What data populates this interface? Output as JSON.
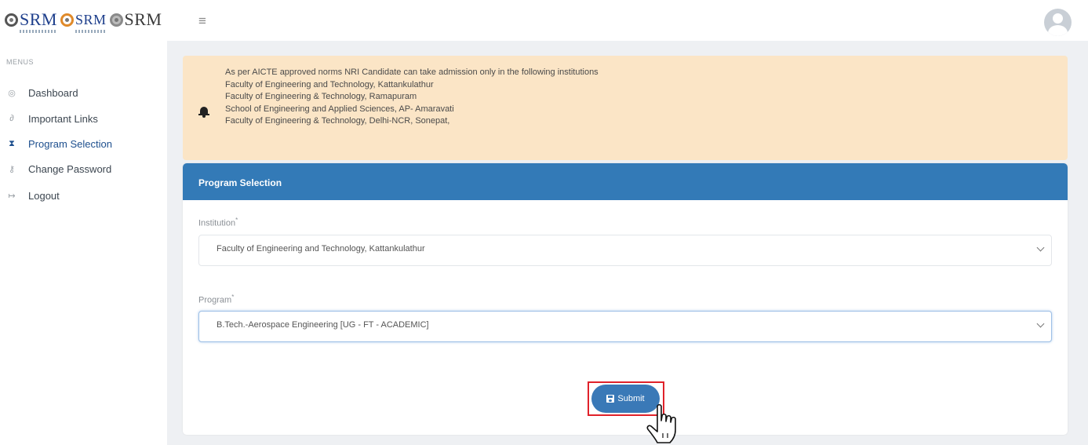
{
  "header": {
    "logos": [
      {
        "text": "SRM"
      },
      {
        "text": "SRM"
      },
      {
        "text": "SRM"
      }
    ],
    "menu_icon": "hamburger-icon",
    "avatar_icon": "user-avatar-icon"
  },
  "sidebar": {
    "section_label": "MENUS",
    "items": [
      {
        "label": "Dashboard",
        "icon": "dashboard-icon",
        "active": false
      },
      {
        "label": "Important Links",
        "icon": "link-icon",
        "active": false
      },
      {
        "label": "Program Selection",
        "icon": "hourglass-icon",
        "active": true
      },
      {
        "label": "Change Password",
        "icon": "key-icon",
        "active": false
      },
      {
        "label": "Logout",
        "icon": "logout-icon",
        "active": false
      }
    ]
  },
  "alert": {
    "icon": "bell-icon",
    "lines": [
      "As per AICTE approved norms NRI Candidate can take admission only in the following institutions",
      "Faculty of Engineering and Technology, Kattankulathur",
      "Faculty of Engineering & Technology, Ramapuram",
      "School of Engineering and Applied Sciences, AP- Amaravati",
      "Faculty of Engineering & Technology, Delhi-NCR, Sonepat,"
    ]
  },
  "card": {
    "title": "Program Selection",
    "institution": {
      "label": "Institution",
      "required_mark": "*",
      "selected": "Faculty of Engineering and Technology, Kattankulathur"
    },
    "program": {
      "label": "Program",
      "required_mark": "*",
      "selected": "B.Tech.-Aerospace Engineering [UG - FT - ACADEMIC]"
    },
    "submit_label": "Submit",
    "submit_icon": "save-icon"
  },
  "colors": {
    "primary": "#337ab7",
    "alert_bg": "#fbe5c6",
    "highlight": "#e0222a",
    "active_nav": "#1d4f8e"
  }
}
